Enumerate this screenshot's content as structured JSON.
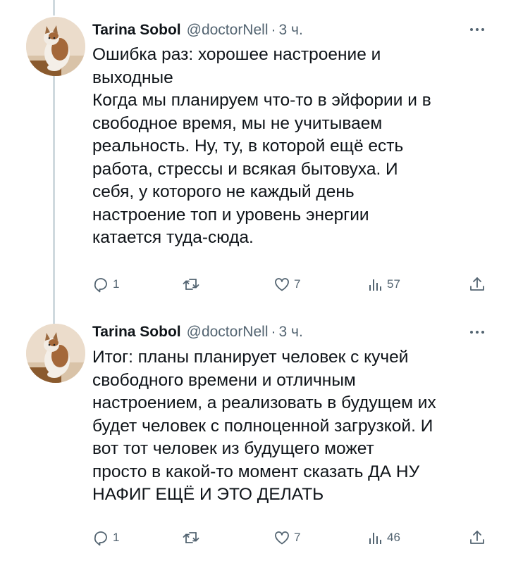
{
  "tweets": [
    {
      "author_name": "Tarina Sobol",
      "handle": "@doctorNell",
      "separator": "·",
      "time": "3 ч.",
      "avatar_icon": "cat-avatar",
      "text_lines": [
        "Ошибка раз: хорошее настроение и",
        "выходные",
        "Когда мы планируем что-то в эйфории и в",
        "свободное время, мы не учитываем",
        "реальность. Ну, ту, в которой ещё есть",
        "работа, стрессы и всякая бытовуха. И",
        "себя, у которого не каждый день",
        "настроение топ и уровень энергии",
        "катается туда-сюда."
      ],
      "replies": "1",
      "retweets": "",
      "likes": "7",
      "views": "57"
    },
    {
      "author_name": "Tarina Sobol",
      "handle": "@doctorNell",
      "separator": "·",
      "time": "3 ч.",
      "avatar_icon": "cat-avatar",
      "text_lines": [
        "Итог: планы планирует человек с кучей",
        "свободного времени и отличным",
        "настроением, а реализовать в будущем их",
        "будет человек с полноценной загрузкой. И",
        "вот тот человек из будущего может",
        "просто в какой-то момент сказать ДА НУ",
        "НАФИГ ЕЩЁ И ЭТО ДЕЛАТЬ"
      ],
      "replies": "1",
      "retweets": "",
      "likes": "7",
      "views": "46"
    }
  ],
  "icons": {
    "reply": "reply-icon",
    "retweet": "retweet-icon",
    "like": "like-icon",
    "views": "views-icon",
    "share": "share-icon",
    "more": "more-options-icon"
  },
  "colors": {
    "text": "#0f1419",
    "secondary": "#536471",
    "thread_line": "#cfd9de",
    "background": "#ffffff"
  }
}
